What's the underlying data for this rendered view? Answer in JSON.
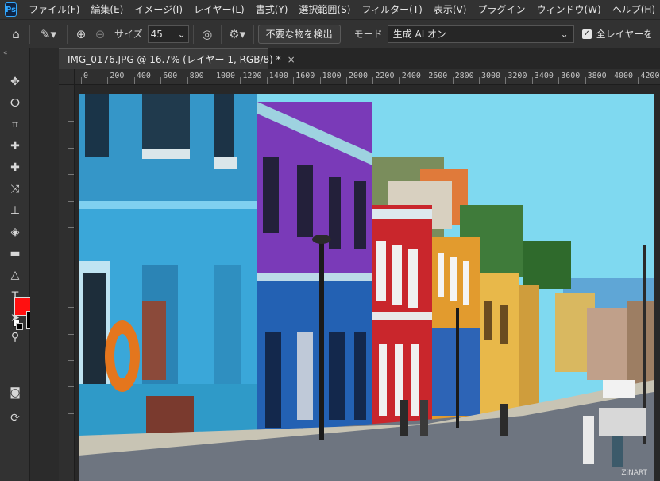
{
  "app": {
    "logo_text": "Ps"
  },
  "menu": [
    "ファイル(F)",
    "編集(E)",
    "イメージ(I)",
    "レイヤー(L)",
    "書式(Y)",
    "選択範囲(S)",
    "フィルター(T)",
    "表示(V)",
    "プラグイン",
    "ウィンドウ(W)",
    "ヘルプ(H)"
  ],
  "options": {
    "size_label": "サイズ",
    "size_value": "45",
    "remove_button": "不要な物を検出",
    "mode_label": "モード",
    "mode_value": "生成 AI オン",
    "all_layers_label": "全レイヤーを"
  },
  "document": {
    "tab_title": "IMG_0176.JPG @ 16.7% (レイヤー 1, RGB/8) *",
    "close": "×"
  },
  "ruler": {
    "h_ticks": [
      "0",
      "200",
      "400",
      "600",
      "800",
      "1000",
      "1200",
      "1400",
      "1600",
      "1800",
      "2000",
      "2200",
      "2400",
      "2600",
      "2800",
      "3000",
      "3200",
      "3400",
      "3600",
      "3800",
      "4000",
      "4200"
    ]
  },
  "colors": {
    "foreground": "#ff1010",
    "background": "#000000",
    "accent": "#31a8ff"
  },
  "photo": {
    "watermark": "ZiNART"
  }
}
